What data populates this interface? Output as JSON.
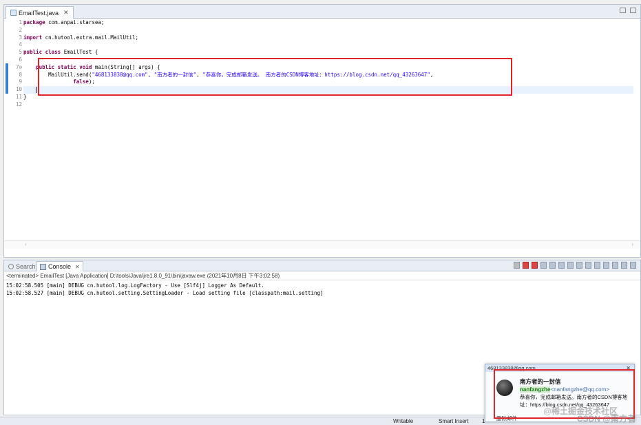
{
  "editor": {
    "tab_label": "EmailTest.java",
    "lines": [
      {
        "num": "1",
        "segs": [
          {
            "t": "package",
            "c": "kw"
          },
          {
            "t": " com.anpai.starsea;"
          }
        ]
      },
      {
        "num": "2",
        "segs": []
      },
      {
        "num": "3",
        "segs": [
          {
            "t": "import",
            "c": "kw"
          },
          {
            "t": " cn.hutool.extra.mail.MailUtil;"
          }
        ]
      },
      {
        "num": "4",
        "segs": []
      },
      {
        "num": "5",
        "segs": [
          {
            "t": "public",
            "c": "kw"
          },
          {
            "t": " "
          },
          {
            "t": "class",
            "c": "kw"
          },
          {
            "t": " EmailTest {"
          }
        ]
      },
      {
        "num": "6",
        "segs": []
      },
      {
        "num": "7⊖",
        "segs": [
          {
            "t": "    "
          },
          {
            "t": "public",
            "c": "kw"
          },
          {
            "t": " "
          },
          {
            "t": "static",
            "c": "kw"
          },
          {
            "t": " "
          },
          {
            "t": "void",
            "c": "kw"
          },
          {
            "t": " main(String[] args) {"
          }
        ]
      },
      {
        "num": "8",
        "segs": [
          {
            "t": "        MailUtil.send("
          },
          {
            "t": "\"468133838@qq.com\"",
            "c": "str"
          },
          {
            "t": ", "
          },
          {
            "t": "\"南方者的一封信\"",
            "c": "str"
          },
          {
            "t": ", "
          },
          {
            "t": "\"恭喜你，完成邮箱发送。 南方者的CSDN博客地址：https://blog.csdn.net/qq_43263647\"",
            "c": "str"
          },
          {
            "t": ","
          }
        ]
      },
      {
        "num": "9",
        "segs": [
          {
            "t": "                "
          },
          {
            "t": "false",
            "c": "kw"
          },
          {
            "t": ");"
          }
        ]
      },
      {
        "num": "10",
        "segs": [
          {
            "t": "    "
          }
        ],
        "current": true,
        "cursor": true
      },
      {
        "num": "11",
        "segs": [
          {
            "t": "}"
          }
        ]
      },
      {
        "num": "12",
        "segs": []
      }
    ]
  },
  "console": {
    "search_tab": "Search",
    "console_tab": "Console",
    "header": "<terminated> EmailTest [Java Application] D:\\tools\\Java\\jre1.8.0_91\\bin\\javaw.exe (2021年10月8日 下午3:02:58)",
    "lines": [
      "15:02:58.505 [main] DEBUG cn.hutool.log.LogFactory - Use [Slf4j] Logger As Default.",
      "15:02:58.527 [main] DEBUG cn.hutool.setting.SettingLoader - Load setting file [classpath:mail.setting]"
    ]
  },
  "statusbar": {
    "writable": "Writable",
    "insert_mode": "Smart Insert",
    "position": "1"
  },
  "popup": {
    "title": "468133838@qq.com",
    "subject": "南方者的一封信",
    "sender_name": "nanfangzhe",
    "sender_email": "<nanfangzhe@qq.com>",
    "body_line1": "恭喜你，完成邮箱发送。南方者的CSDN博客地",
    "body_line2": "址：https://blog.csdn.net/qq_43263647",
    "delete_label": "删除邮件"
  },
  "watermark": {
    "line1": "@稀土掘金技术社区",
    "line2": "CSDN @南方者"
  }
}
